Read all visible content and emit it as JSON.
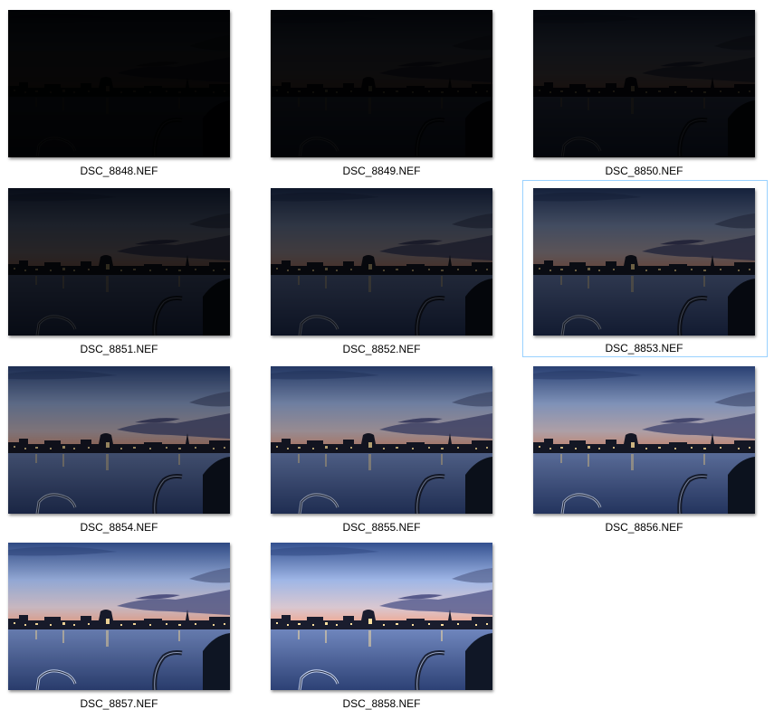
{
  "selected_file": "DSC_8853.NEF",
  "files": [
    {
      "name": "DSC_8848.NEF",
      "brightness": 0.03
    },
    {
      "name": "DSC_8849.NEF",
      "brightness": 0.06
    },
    {
      "name": "DSC_8850.NEF",
      "brightness": 0.1
    },
    {
      "name": "DSC_8851.NEF",
      "brightness": 0.18
    },
    {
      "name": "DSC_8852.NEF",
      "brightness": 0.3
    },
    {
      "name": "DSC_8853.NEF",
      "brightness": 0.42
    },
    {
      "name": "DSC_8854.NEF",
      "brightness": 0.58
    },
    {
      "name": "DSC_8855.NEF",
      "brightness": 0.7
    },
    {
      "name": "DSC_8856.NEF",
      "brightness": 0.8
    },
    {
      "name": "DSC_8857.NEF",
      "brightness": 0.92
    },
    {
      "name": "DSC_8858.NEF",
      "brightness": 1.0
    }
  ],
  "colors": {
    "selection_border": "#99d1ff",
    "sky_top": "#3c5a9e",
    "sky_mid": "#a9bde8",
    "horizon_glow": "#f0a58a",
    "water": "#3e5792",
    "city_lights": "#ffe7a8"
  }
}
